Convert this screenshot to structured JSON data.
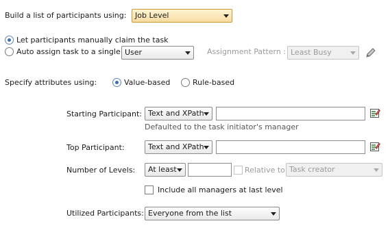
{
  "build_list": {
    "label": "Build a list of participants using:",
    "value": "Job Level"
  },
  "assignment": {
    "manual_label": "Let participants manually claim the task",
    "auto_label": "Auto assign task to a single",
    "auto_select_value": "User",
    "pattern_label": "Assignment Pattern :",
    "pattern_value": "Least Busy"
  },
  "attributes": {
    "label": "Specify attributes using:",
    "value_based": "Value-based",
    "rule_based": "Rule-based"
  },
  "starting_participant": {
    "label": "Starting Participant:",
    "type_value": "Text and XPath",
    "input_value": "",
    "hint": "Defaulted to the task initiator's manager"
  },
  "top_participant": {
    "label": "Top Participant:",
    "type_value": "Text and XPath",
    "input_value": ""
  },
  "levels": {
    "label": "Number of Levels:",
    "mode_value": "At least",
    "count_value": "",
    "relative_label": "Relative to:",
    "relative_value": "Task creator",
    "include_label": "Include all managers at last level"
  },
  "utilized": {
    "label": "Utilized Participants:",
    "value": "Everyone from the list"
  },
  "icons": {
    "edit": "pencil-icon",
    "expression_builder": "expression-builder-icon"
  }
}
